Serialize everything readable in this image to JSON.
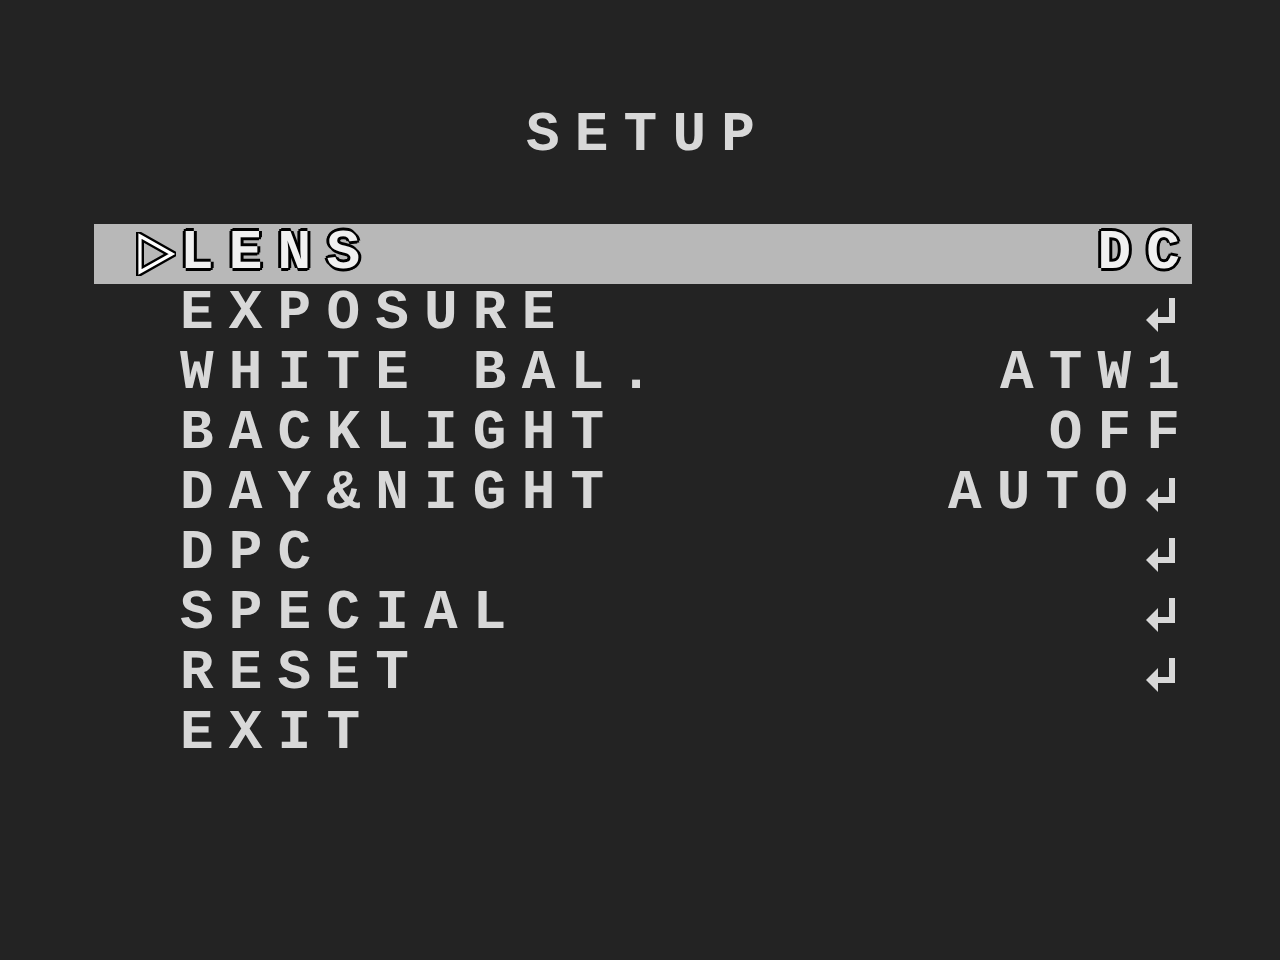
{
  "title": "SETUP",
  "items": [
    {
      "label": "LENS",
      "value": "DC",
      "submenu": false,
      "selected": true
    },
    {
      "label": "EXPOSURE",
      "submenu": true,
      "selected": false
    },
    {
      "label": "WHITE BAL.",
      "value": "ATW1",
      "submenu": false,
      "selected": false
    },
    {
      "label": "BACKLIGHT",
      "value": "OFF",
      "submenu": false,
      "selected": false
    },
    {
      "label": "DAY&NIGHT",
      "value": "AUTO",
      "submenu": true,
      "selected": false
    },
    {
      "label": "DPC",
      "submenu": true,
      "selected": false
    },
    {
      "label": "SPECIAL",
      "submenu": true,
      "selected": false
    },
    {
      "label": "RESET",
      "submenu": true,
      "selected": false
    },
    {
      "label": "EXIT",
      "submenu": false,
      "selected": false
    }
  ]
}
